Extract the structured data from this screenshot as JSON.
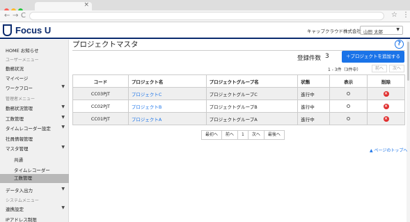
{
  "browser": {
    "dots": [
      "#ff5f57",
      "#febc2e",
      "#28c840"
    ]
  },
  "header": {
    "logo": "Focus U",
    "company": "キャップクラウド株式会社",
    "user": "山田 太郎"
  },
  "sidebar": [
    {
      "label": "HOME お知らせ",
      "type": "item"
    },
    {
      "label": "ユーザーメニュー",
      "type": "sec"
    },
    {
      "label": "勤務状況",
      "type": "item"
    },
    {
      "label": "マイページ",
      "type": "item"
    },
    {
      "label": "ワークフロー",
      "type": "item",
      "arrow": true
    },
    {
      "label": "管理者メニュー",
      "type": "sec"
    },
    {
      "label": "勤務状況管理",
      "type": "item",
      "arrow": true
    },
    {
      "label": "工数管理",
      "type": "item",
      "arrow": true
    },
    {
      "label": "タイムレコーダー設定",
      "type": "item",
      "arrow": true
    },
    {
      "label": "社員情報管理",
      "type": "item"
    },
    {
      "label": "マスタ管理",
      "type": "item",
      "arrow": true
    },
    {
      "label": "共通",
      "type": "sub"
    },
    {
      "label": "タイムレコーダー",
      "type": "sub"
    },
    {
      "label": "工数管理",
      "type": "sub",
      "active": true
    },
    {
      "label": "データ入出力",
      "type": "item",
      "arrow": true
    },
    {
      "label": "システムメニュー",
      "type": "sec"
    },
    {
      "label": "連携設定",
      "type": "item",
      "arrow": true
    },
    {
      "label": "IPアドレス制限",
      "type": "item"
    }
  ],
  "main": {
    "title": "プロジェクトマスタ",
    "help": "?",
    "count_label": "登録件数",
    "count": "3",
    "add_button": "＋プロジェクトを追加する",
    "paging_info": "1 - 3件（3件中）",
    "prev": "前へ",
    "next": "次へ"
  },
  "table": {
    "headers": [
      "コード",
      "プロジェクト名",
      "プロジェクトグループ名",
      "状態",
      "表示",
      "削除"
    ],
    "rows": [
      {
        "code": "CC03PJT",
        "name": "プロジェクトC",
        "group": "プロジェクトグループC",
        "status": "進行中"
      },
      {
        "code": "CC02PJT",
        "name": "プロジェクトB",
        "group": "プロジェクトグループB",
        "status": "進行中"
      },
      {
        "code": "CC01PJT",
        "name": "プロジェクトA",
        "group": "プロジェクトグループA",
        "status": "進行中"
      }
    ]
  },
  "pager": [
    "最初へ",
    "前へ",
    "1",
    "次へ",
    "最後へ"
  ],
  "to_top": "▲ ページのトップへ"
}
